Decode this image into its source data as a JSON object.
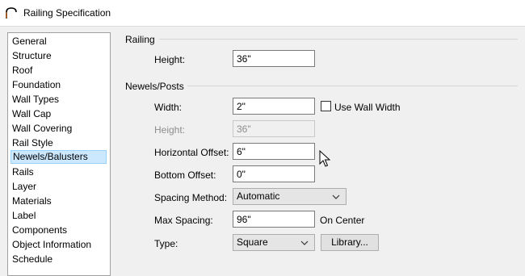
{
  "window": {
    "title": "Railing Specification"
  },
  "sidebar": {
    "items": [
      {
        "label": "General"
      },
      {
        "label": "Structure"
      },
      {
        "label": "Roof"
      },
      {
        "label": "Foundation"
      },
      {
        "label": "Wall Types"
      },
      {
        "label": "Wall Cap"
      },
      {
        "label": "Wall Covering"
      },
      {
        "label": "Rail Style"
      },
      {
        "label": "Newels/Balusters",
        "selected": true
      },
      {
        "label": "Rails"
      },
      {
        "label": "Layer"
      },
      {
        "label": "Materials"
      },
      {
        "label": "Label"
      },
      {
        "label": "Components"
      },
      {
        "label": "Object Information"
      },
      {
        "label": "Schedule"
      }
    ]
  },
  "railing": {
    "section_title": "Railing",
    "height_label": "Height:",
    "height_value": "36\""
  },
  "newels": {
    "section_title": "Newels/Posts",
    "width_label": "Width:",
    "width_value": "2\"",
    "use_wall_width_label": "Use Wall Width",
    "use_wall_width_checked": false,
    "height_label": "Height:",
    "height_value": "36\"",
    "horizontal_offset_label": "Horizontal Offset:",
    "horizontal_offset_value": "6\"",
    "bottom_offset_label": "Bottom Offset:",
    "bottom_offset_value": "0\"",
    "spacing_method_label": "Spacing Method:",
    "spacing_method_value": "Automatic",
    "max_spacing_label": "Max Spacing:",
    "max_spacing_value": "96\"",
    "on_center_label": "On Center",
    "type_label": "Type:",
    "type_value": "Square",
    "library_button_label": "Library..."
  },
  "icons": {
    "title": "railing-arch-icon",
    "dropdown": "chevron-down-icon",
    "pointer": "mouse-pointer-icon"
  }
}
